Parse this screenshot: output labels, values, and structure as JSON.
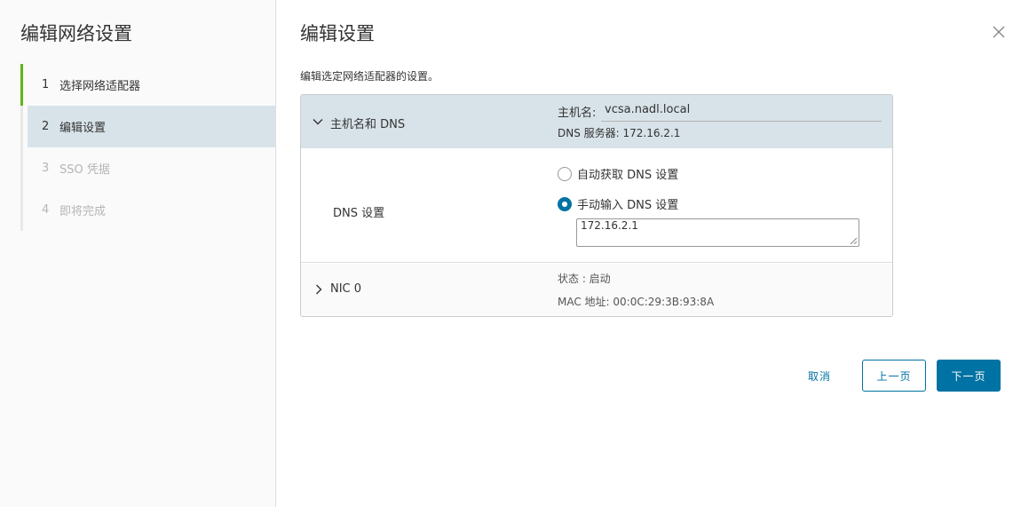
{
  "nav": {
    "title": "编辑网络设置",
    "steps": [
      {
        "num": "1",
        "label": "选择网络适配器"
      },
      {
        "num": "2",
        "label": "编辑设置"
      },
      {
        "num": "3",
        "label": "SSO 凭据"
      },
      {
        "num": "4",
        "label": "即将完成"
      }
    ]
  },
  "main": {
    "title": "编辑设置",
    "description": "编辑选定网络适配器的设置。"
  },
  "host_row": {
    "label": "主机名和 DNS",
    "hostname_label": "主机名:",
    "hostname_value": "vcsa.nadl.local",
    "dns_server_text": "DNS 服务器: 172.16.2.1"
  },
  "dns_row": {
    "label": "DNS 设置",
    "option_auto": "自动获取 DNS 设置",
    "option_manual": "手动输入 DNS 设置",
    "selected": "manual",
    "dns_value": "172.16.2.1"
  },
  "nic_row": {
    "label": "NIC 0",
    "status": "状态 : 启动",
    "mac": "MAC 地址: 00:0C:29:3B:93:8A"
  },
  "footer": {
    "cancel": "取消",
    "prev": "上一页",
    "next": "下一页"
  },
  "colors": {
    "accent": "#0072a3",
    "step_done": "#60b515",
    "active_bg": "#d8e3e9"
  }
}
